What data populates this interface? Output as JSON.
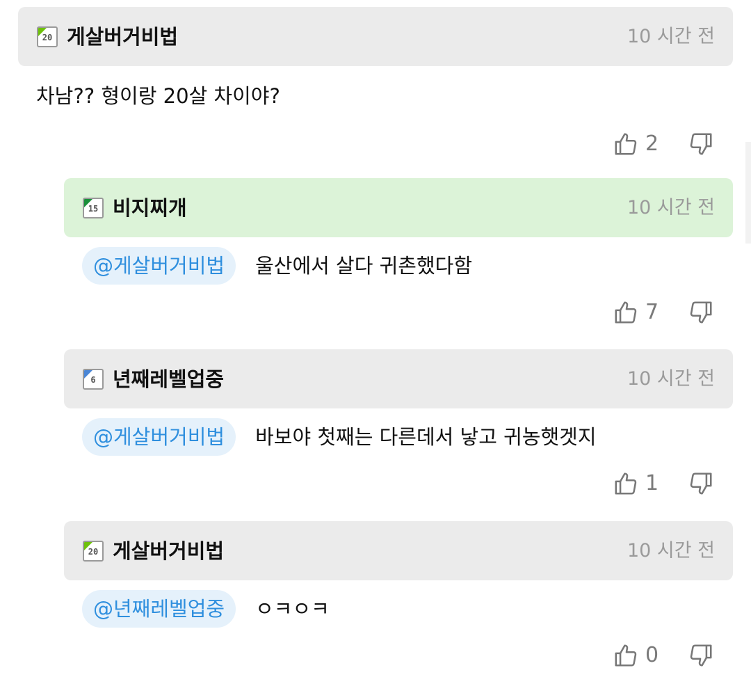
{
  "comments": [
    {
      "level": "20",
      "level_color": "#6ec10a",
      "nickname": "게살버거비법",
      "time": "10 시간 전",
      "mention": "",
      "text": "차남?? 형이랑 20살 차이야?",
      "likes": "2"
    },
    {
      "level": "15",
      "level_color": "#1a8f3a",
      "nickname": "비지찌개",
      "time": "10 시간 전",
      "mention": "@게살버거비법",
      "text": "울산에서 살다 귀촌했다함",
      "likes": "7"
    },
    {
      "level": "6",
      "level_color": "#4a86d6",
      "nickname": "년째레벨업중",
      "time": "10 시간 전",
      "mention": "@게살버거비법",
      "text": "바보야 첫째는 다른데서 낳고 귀농햇겟지",
      "likes": "1"
    },
    {
      "level": "20",
      "level_color": "#6ec10a",
      "nickname": "게살버거비법",
      "time": "10 시간 전",
      "mention": "@년째레벨업중",
      "text": "ㅇㅋㅇㅋ",
      "likes": "0"
    }
  ],
  "icons": {
    "like": "thumbs-up-icon",
    "dislike": "thumbs-down-icon"
  },
  "colors": {
    "header_default": "#ebebeb",
    "header_highlight": "#dcf3d8",
    "mention_text": "#2f8fde",
    "mention_bg": "#e5f1fb"
  }
}
